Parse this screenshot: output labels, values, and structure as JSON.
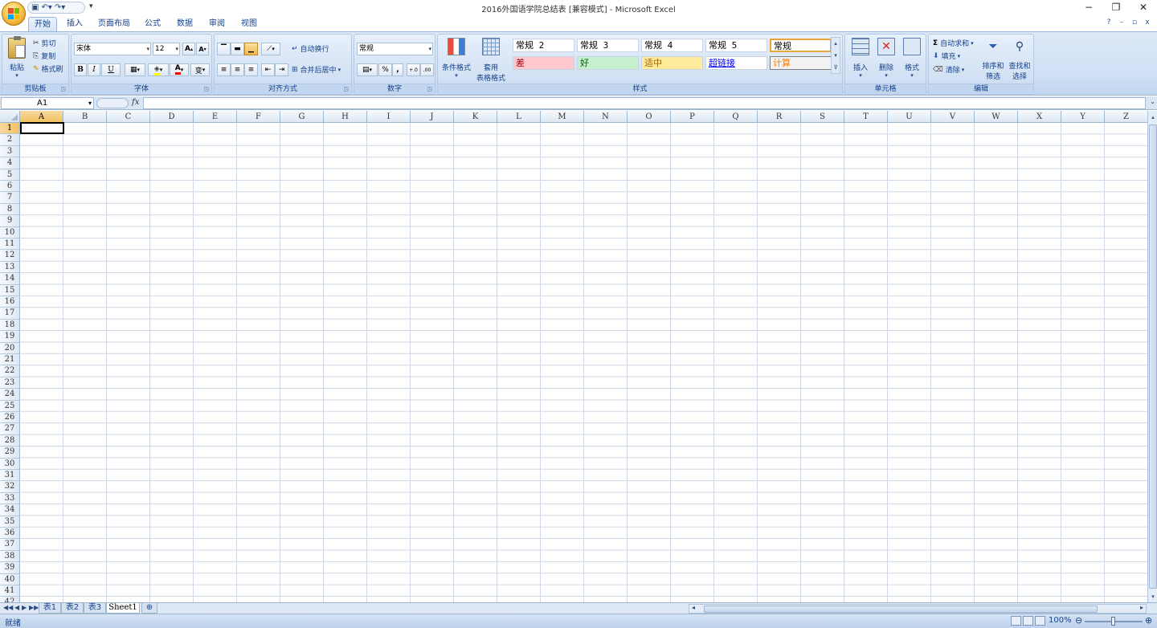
{
  "window": {
    "title": "2016外国语学院总结表 [兼容模式] - Microsoft Excel",
    "controls": {
      "minimize": "−",
      "restore": "❐",
      "close": "✕"
    }
  },
  "qat": {
    "save_icon": "save-icon",
    "undo_icon": "undo-icon",
    "redo_icon": "redo-icon",
    "more": "▾"
  },
  "ribbon_tabs": [
    "开始",
    "插入",
    "页面布局",
    "公式",
    "数据",
    "审阅",
    "视图"
  ],
  "active_tab": "开始",
  "tab_right": {
    "help": "?",
    "min": "–",
    "restore": "▫",
    "close": "x"
  },
  "clipboard": {
    "paste": "粘贴",
    "cut": "剪切",
    "copy": "复制",
    "format_painter": "格式刷",
    "label": "剪贴板"
  },
  "font": {
    "family": "宋体",
    "size": "12",
    "grow": "A",
    "shrink": "A",
    "bold": "B",
    "italic": "I",
    "underline": "U",
    "color_letter": "A",
    "phonetic": "变",
    "label": "字体"
  },
  "alignment": {
    "wrap_text": "自动换行",
    "merge_center": "合并后居中",
    "label": "对齐方式"
  },
  "number": {
    "format": "常规",
    "percent": "%",
    "comma": ",",
    "inc_decimal": ".0 .00",
    "dec_decimal": ".00 .0",
    "label": "数字"
  },
  "styles": {
    "conditional": "条件格式",
    "table_format_1": "套用",
    "table_format_2": "表格格式",
    "cells": [
      {
        "text": "常规 2",
        "bg": "#ffffff",
        "color": "#000000"
      },
      {
        "text": "常规 3",
        "bg": "#ffffff",
        "color": "#000000"
      },
      {
        "text": "常规 4",
        "bg": "#ffffff",
        "color": "#000000"
      },
      {
        "text": "常规 5",
        "bg": "#ffffff",
        "color": "#000000"
      },
      {
        "text": "常规",
        "bg": "#ffffff",
        "color": "#000000"
      },
      {
        "text": "差",
        "bg": "#ffc7ce",
        "color": "#9c0006"
      },
      {
        "text": "好",
        "bg": "#c6efce",
        "color": "#006100"
      },
      {
        "text": "适中",
        "bg": "#ffeb9c",
        "color": "#9c6500"
      },
      {
        "text": "超链接",
        "bg": "#ffffff",
        "color": "#0000ff"
      },
      {
        "text": "计算",
        "bg": "#f2f2f2",
        "color": "#fa7d00"
      }
    ],
    "label": "样式"
  },
  "cells_group": {
    "insert": "插入",
    "delete": "删除",
    "format": "格式",
    "label": "单元格"
  },
  "editing": {
    "autosum": "自动求和",
    "fill": "填充",
    "clear": "清除",
    "sort_filter_1": "排序和",
    "sort_filter_2": "筛选",
    "find_select_1": "查找和",
    "find_select_2": "选择",
    "label": "编辑"
  },
  "formula_bar": {
    "name_box": "A1",
    "fx": "fx",
    "value": ""
  },
  "columns": [
    "A",
    "B",
    "C",
    "D",
    "E",
    "F",
    "G",
    "H",
    "I",
    "J",
    "K",
    "L",
    "M",
    "N",
    "O",
    "P",
    "Q",
    "R",
    "S",
    "T",
    "U",
    "V",
    "W",
    "X",
    "Y",
    "Z"
  ],
  "rows": [
    "1",
    "2",
    "3",
    "4",
    "5",
    "6",
    "7",
    "8",
    "9",
    "10",
    "11",
    "12",
    "13",
    "14",
    "15",
    "16",
    "17",
    "18",
    "19",
    "20",
    "21",
    "22",
    "23",
    "24",
    "25",
    "26",
    "27",
    "28",
    "29",
    "30",
    "31",
    "32",
    "33",
    "34",
    "35",
    "36",
    "37",
    "38",
    "39",
    "40",
    "41",
    "42"
  ],
  "selected_cell": "A1",
  "sheets": [
    "表1",
    "表2",
    "表3",
    "Sheet1"
  ],
  "active_sheet": "Sheet1",
  "status": {
    "text": "就绪",
    "zoom": "100%"
  }
}
